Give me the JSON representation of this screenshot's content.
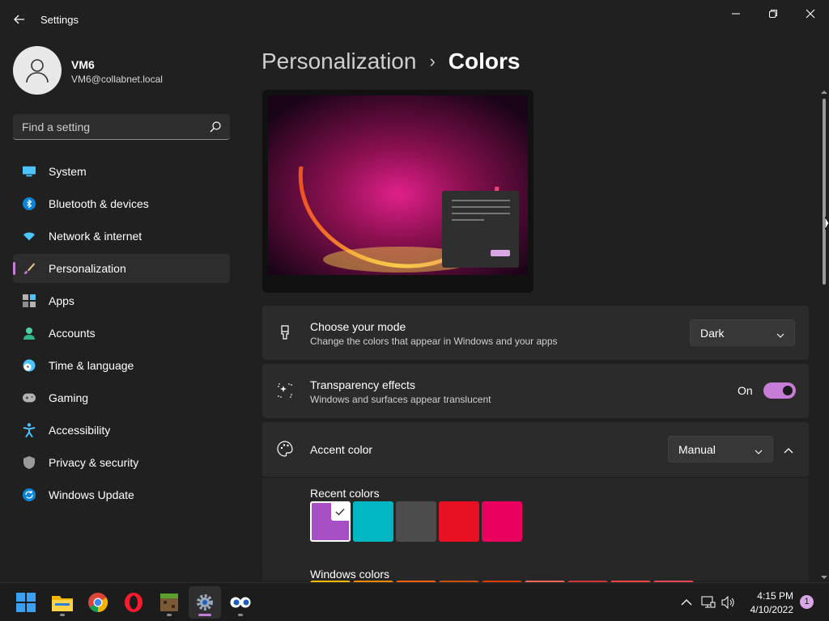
{
  "window": {
    "title": "Settings"
  },
  "profile": {
    "name": "VM6",
    "email": "VM6@collabnet.local"
  },
  "search": {
    "placeholder": "Find a setting"
  },
  "sidebar": {
    "items": [
      {
        "label": "System",
        "icon": "monitor-icon"
      },
      {
        "label": "Bluetooth & devices",
        "icon": "bluetooth-icon"
      },
      {
        "label": "Network & internet",
        "icon": "wifi-icon"
      },
      {
        "label": "Personalization",
        "icon": "paintbrush-icon",
        "active": true
      },
      {
        "label": "Apps",
        "icon": "apps-icon"
      },
      {
        "label": "Accounts",
        "icon": "person-icon"
      },
      {
        "label": "Time & language",
        "icon": "clock-globe-icon"
      },
      {
        "label": "Gaming",
        "icon": "gamepad-icon"
      },
      {
        "label": "Accessibility",
        "icon": "accessibility-icon"
      },
      {
        "label": "Privacy & security",
        "icon": "shield-icon"
      },
      {
        "label": "Windows Update",
        "icon": "update-icon"
      }
    ]
  },
  "breadcrumb": {
    "parent": "Personalization",
    "separator": "›",
    "current": "Colors"
  },
  "mode": {
    "title": "Choose your mode",
    "subtitle": "Change the colors that appear in Windows and your apps",
    "value": "Dark"
  },
  "transparency": {
    "title": "Transparency effects",
    "subtitle": "Windows and surfaces appear translucent",
    "state_label": "On",
    "enabled": true
  },
  "accent": {
    "title": "Accent color",
    "value": "Manual",
    "recent_label": "Recent colors",
    "recent_colors": [
      "#a84fc5",
      "#00b7c3",
      "#4c4c4c",
      "#e81123",
      "#ea005e"
    ],
    "selected_index": 0,
    "windows_label": "Windows colors",
    "windows_colors": [
      "#ffb900",
      "#ff8c00",
      "#f7630c",
      "#ca5010",
      "#da3b01",
      "#ef6950",
      "#d13438",
      "#ff4343",
      "#e74856"
    ]
  },
  "colors": {
    "accent": "#c77dd8",
    "background": "#202020",
    "card": "#2b2b2b"
  },
  "taskbar": {
    "apps": [
      {
        "icon": "windows-start-icon"
      },
      {
        "icon": "file-explorer-icon"
      },
      {
        "icon": "chrome-icon"
      },
      {
        "icon": "opera-icon"
      },
      {
        "icon": "minecraft-icon"
      },
      {
        "icon": "settings-gear-icon",
        "active": true
      },
      {
        "icon": "tweaking-app-icon"
      }
    ],
    "time": "4:15 PM",
    "date": "4/10/2022",
    "notification_count": "1"
  }
}
